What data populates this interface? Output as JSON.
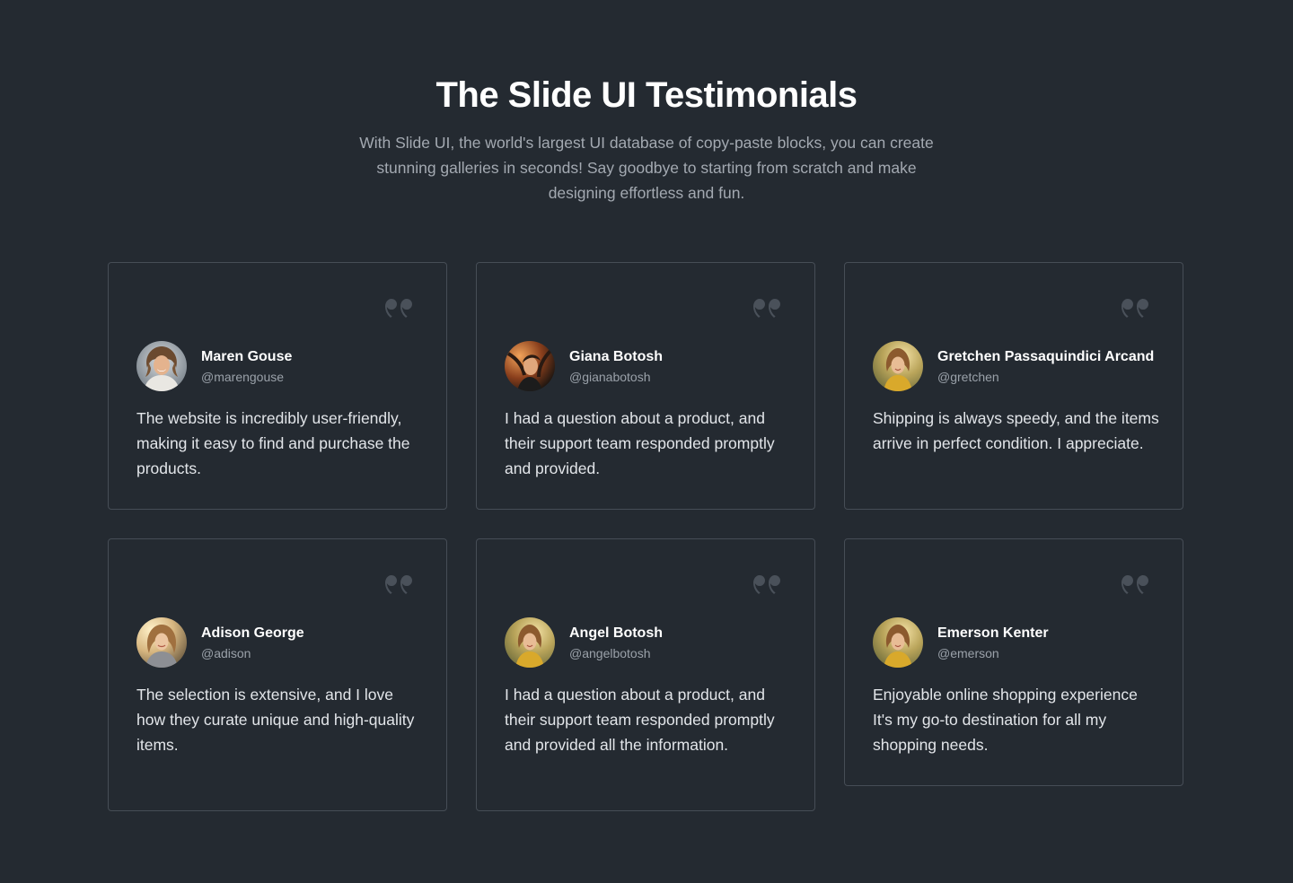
{
  "header": {
    "title": "The Slide UI Testimonials",
    "subtitle": "With Slide UI, the world's largest UI database of copy-paste blocks, you can create stunning galleries in seconds! Say goodbye to starting from scratch and make designing effortless and fun."
  },
  "colors": {
    "background": "#242a31",
    "card_border": "#464d56",
    "muted_text": "#a3a9b1",
    "quote_icon": "#4a515a"
  },
  "testimonials": [
    {
      "name": "Maren Gouse",
      "handle": "@marengouse",
      "quote": "The website is incredibly user-friendly, making it easy to find and purchase the products.",
      "avatar": "avatar-laughing-woman"
    },
    {
      "name": "Giana Botosh",
      "handle": "@gianabotosh",
      "quote": "I had a question about a product, and their support team responded promptly and provided.",
      "avatar": "avatar-woman-dark-orange"
    },
    {
      "name": "Gretchen Passaquindici Arcand",
      "handle": "@gretchen",
      "quote": "Shipping is always speedy, and the items arrive in perfect condition. I appreciate.",
      "avatar": "avatar-woman-field"
    },
    {
      "name": "Adison George",
      "handle": "@adison",
      "quote": "The selection is extensive, and I love how they curate unique and high-quality items.",
      "avatar": "avatar-woman-sunlight"
    },
    {
      "name": "Angel Botosh",
      "handle": "@angelbotosh",
      "quote": "I had a question about a product, and their support team responded promptly and provided all the information.",
      "avatar": "avatar-woman-field"
    },
    {
      "name": "Emerson Kenter",
      "handle": "@emerson",
      "quote": "Enjoyable online shopping experience It's my go-to destination for all my shopping needs.",
      "avatar": "avatar-woman-field"
    }
  ]
}
